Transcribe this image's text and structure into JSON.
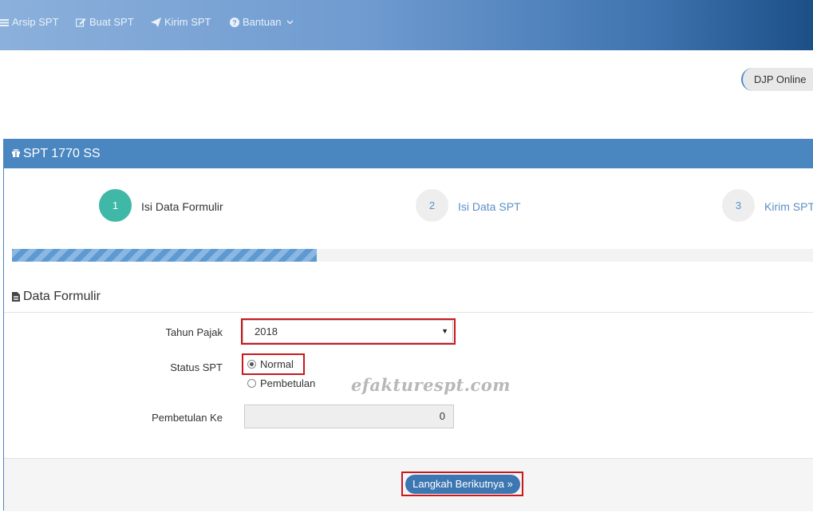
{
  "nav": {
    "items": [
      {
        "label": "Arsip SPT",
        "icon": "list-icon"
      },
      {
        "label": "Buat SPT",
        "icon": "edit-icon"
      },
      {
        "label": "Kirim SPT",
        "icon": "send-icon"
      },
      {
        "label": "Bantuan",
        "icon": "question-icon"
      }
    ]
  },
  "djp_button": "DJP Online",
  "panel": {
    "title": "SPT 1770 SS",
    "steps": [
      {
        "number": "1",
        "label": "Isi Data Formulir",
        "state": "active"
      },
      {
        "number": "2",
        "label": "Isi Data SPT",
        "state": "inactive"
      },
      {
        "number": "3",
        "label": "Kirim SPT",
        "state": "inactive"
      }
    ],
    "progress_percent": 38
  },
  "form": {
    "section_title": "Data Formulir",
    "tahun_label": "Tahun Pajak",
    "tahun_value": "2018",
    "status_label": "Status SPT",
    "status_options": [
      {
        "label": "Normal",
        "checked": true
      },
      {
        "label": "Pembetulan",
        "checked": false
      }
    ],
    "pembetulan_label": "Pembetulan Ke",
    "pembetulan_value": "0"
  },
  "next_button": "Langkah Berikutnya",
  "watermark": "efakturespt.com",
  "colors": {
    "header": "#4a86c0",
    "active_step": "#3fb8a8",
    "highlight": "#c8181e",
    "button": "#3d77b1"
  }
}
